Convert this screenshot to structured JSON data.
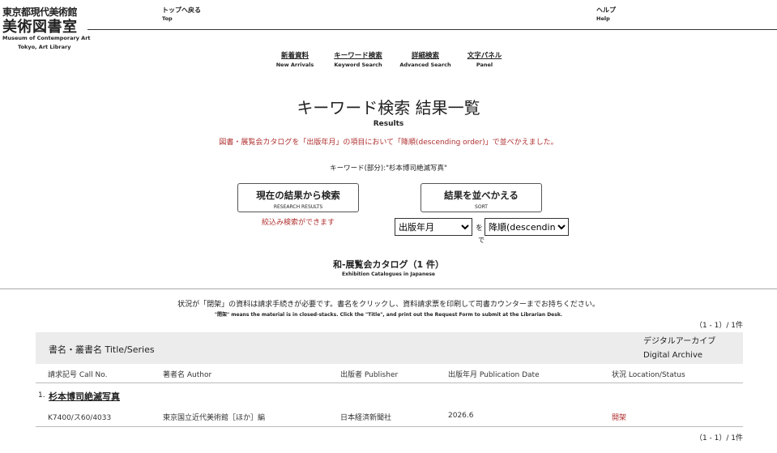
{
  "header": {
    "logo_line1": "東京都現代美術館",
    "logo_line2": "美術図書室",
    "logo_line3": "Museum of Contemporary Art",
    "logo_line4": "Tokyo, Art Library",
    "top_ja": "トップへ戻る",
    "top_en": "Top",
    "help_ja": "ヘルプ",
    "help_en": "Help"
  },
  "nav": [
    {
      "ja": "新着資料",
      "en": "New Arrivals"
    },
    {
      "ja": "キーワード検索",
      "en": "Keyword Search"
    },
    {
      "ja": "詳細検索",
      "en": "Advanced Search"
    },
    {
      "ja": "文字パネル",
      "en": "Panel"
    }
  ],
  "page": {
    "title": "キーワード検索 結果一覧",
    "subtitle": "Results",
    "sort_message": "図書・展覧会カタログを「出版年月」の項目において「降順(descending order)」で並べかえました。",
    "keyword_line": "キーワード(部分):\"杉本博司絶滅写真\""
  },
  "research": {
    "label_ja": "現在の結果から検索",
    "label_en": "RESEARCH RESULTS",
    "hint": "絞込み検索ができます"
  },
  "sort": {
    "label_ja": "結果を並べかえる",
    "label_en": "SORT",
    "field_selected": "出版年月",
    "wo": "を",
    "order_selected": "降順(descending",
    "de": "で"
  },
  "section": {
    "title": "和-展覧会カタログ（1 件）",
    "subtitle": "Exhibition Catalogues in Japanese"
  },
  "notice": {
    "ja": "状況が「閉架」の資料は請求手続きが必要です。書名をクリックし、資料請求票を印刷して司書カウンターまでお持ちください。",
    "en": "\"閉架\" means the material is in closed-stacks. Click the \"Title\", and print out the Request Form to submit at the Librarian Desk."
  },
  "count_top": "（1 - 1）/ 1件",
  "count_bottom": "（1 - 1）/ 1件",
  "table": {
    "title_header": "書名・叢書名 Title/Series",
    "da_header_ja": "デジタルアーカイブ",
    "da_header_en": "Digital Archive",
    "col_call": "請求記号 Call No.",
    "col_author": "著者名 Author",
    "col_publisher": "出版者 Publisher",
    "col_date": "出版年月 Publication Date",
    "col_status": "状況 Location/Status"
  },
  "records": [
    {
      "num": "1.",
      "title": "杉本博司絶滅写真",
      "call_no": "K7400/ス60/4033",
      "author": "東京国立近代美術館［ほか］編",
      "publisher": "日本経済新聞社",
      "date": "2026.6",
      "status": "開架"
    }
  ],
  "colors": {
    "accent_red": "#b03030",
    "table_header_bg": "#ececec"
  }
}
